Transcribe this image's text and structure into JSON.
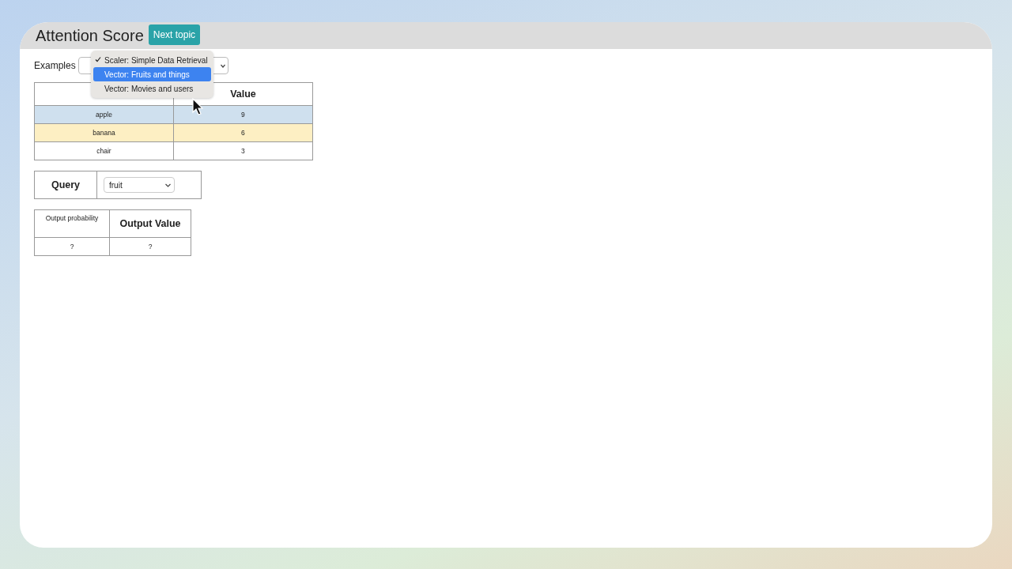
{
  "header": {
    "title": "Attention Score",
    "next_button": "Next topic"
  },
  "examples": {
    "label": "Examples",
    "menu": [
      {
        "label": "Scaler: Simple Data Retrieval",
        "checked": true,
        "selected": false
      },
      {
        "label": "Vector: Fruits and things",
        "checked": false,
        "selected": true
      },
      {
        "label": "Vector: Movies and users",
        "checked": false,
        "selected": false
      }
    ]
  },
  "kv_table": {
    "columns": [
      "Value"
    ],
    "rows": [
      {
        "key": "apple",
        "value": "9",
        "color": "#cfe0ee"
      },
      {
        "key": "banana",
        "value": "6",
        "color": "#fdefc3"
      },
      {
        "key": "chair",
        "value": "3",
        "color": "#ffffff"
      }
    ]
  },
  "query": {
    "label": "Query",
    "value": "fruit"
  },
  "output_table": {
    "columns": [
      "Output probability",
      "Output Value"
    ],
    "rows": [
      [
        "?",
        "?"
      ]
    ]
  }
}
